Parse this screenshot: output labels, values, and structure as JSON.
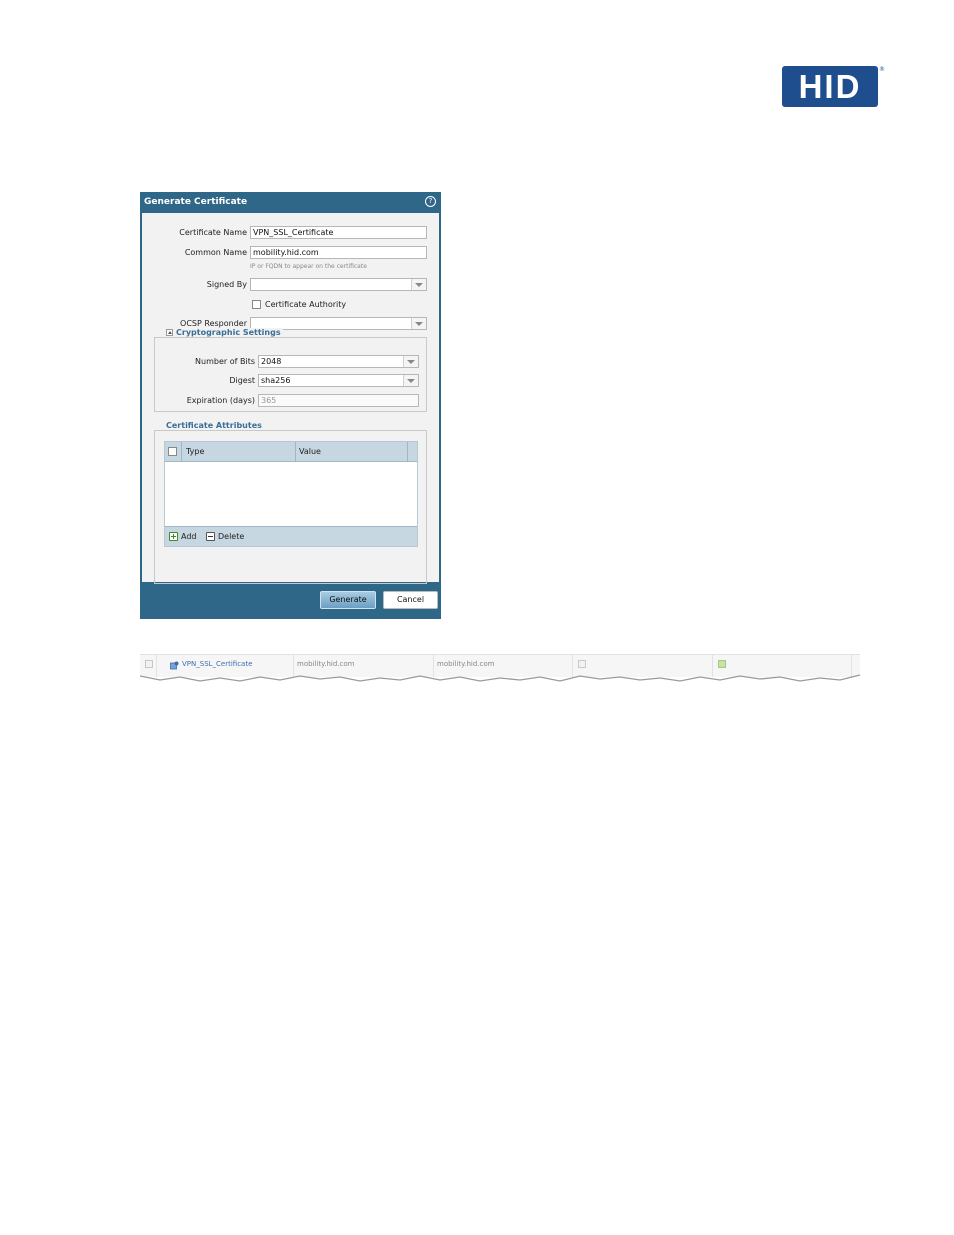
{
  "logo": {
    "text": "HID",
    "reg": "®"
  },
  "dialog": {
    "title": "Generate Certificate",
    "fields": {
      "certificate_name_label": "Certificate Name",
      "certificate_name_value": "VPN_SSL_Certificate",
      "common_name_label": "Common Name",
      "common_name_value": "mobility.hid.com",
      "common_name_hint": "IP or FQDN to appear on the certificate",
      "signed_by_label": "Signed By",
      "signed_by_value": "",
      "certificate_authority_label": "Certificate Authority",
      "ocsp_label": "OCSP Responder",
      "ocsp_value": ""
    },
    "crypto": {
      "legend": "Cryptographic Settings",
      "bits_label": "Number of Bits",
      "bits_value": "2048",
      "digest_label": "Digest",
      "digest_value": "sha256",
      "expiration_label": "Expiration (days)",
      "expiration_value": "365"
    },
    "attributes": {
      "legend": "Certificate Attributes",
      "columns": [
        "Type",
        "Value"
      ],
      "add_label": "Add",
      "delete_label": "Delete"
    },
    "buttons": {
      "generate": "Generate",
      "cancel": "Cancel"
    }
  },
  "list_row": {
    "name": "VPN_SSL_Certificate",
    "subject": "mobility.hid.com",
    "issuer": "mobility.hid.com",
    "ca": false,
    "key": true
  },
  "colors": {
    "header": "#2f6788",
    "logo": "#1f4e8e",
    "legend": "#3a6f97"
  }
}
